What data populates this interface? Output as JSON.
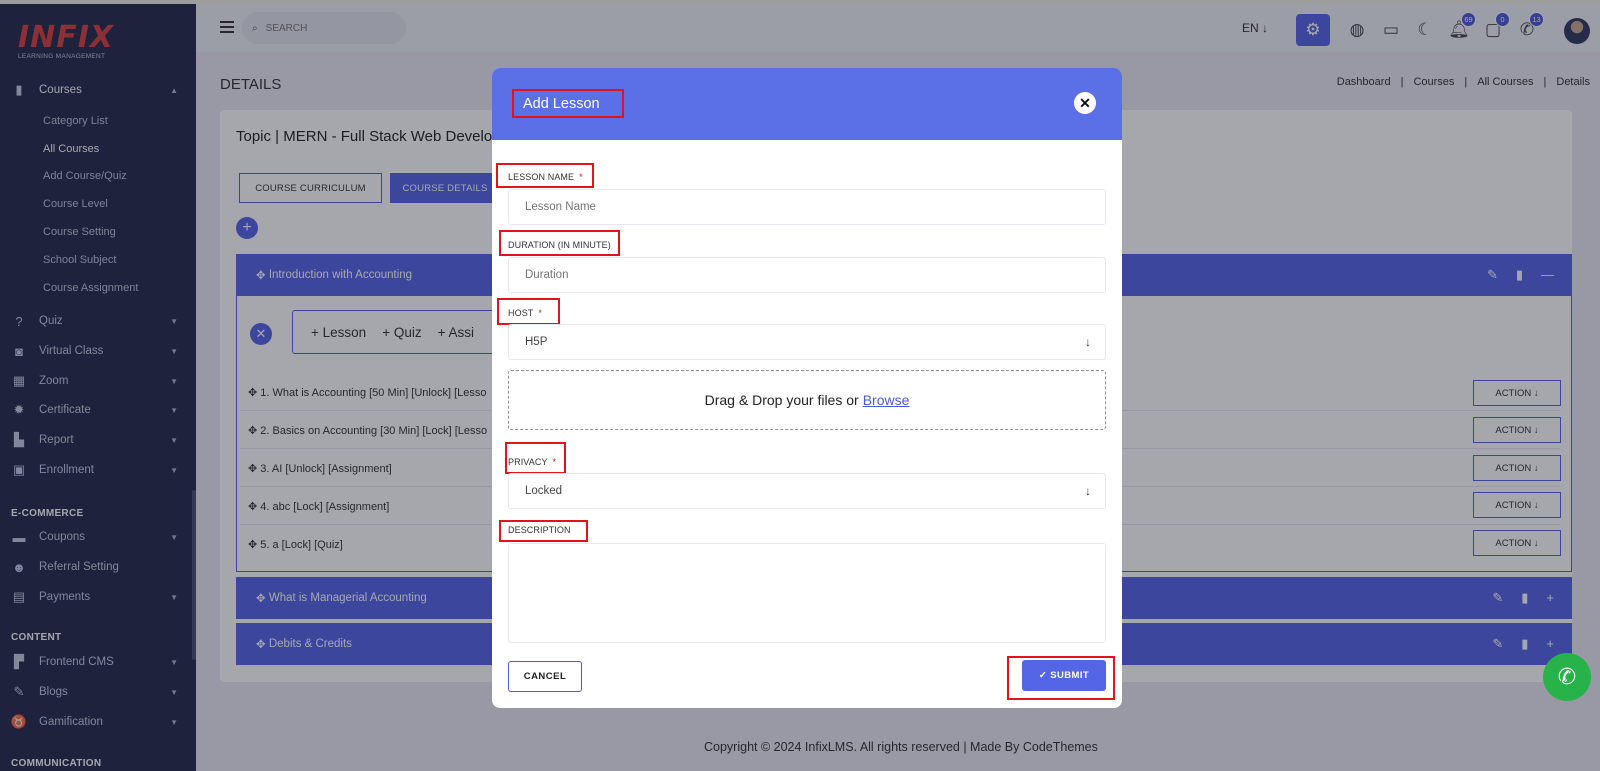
{
  "sidebar": {
    "logo_text": "INFIX",
    "logo_sub": "LEARNING MANAGEMENT",
    "items": [
      {
        "label": "Courses",
        "icon": "book-icon"
      },
      {
        "label": "Quiz",
        "icon": "question-icon"
      },
      {
        "label": "Virtual Class",
        "icon": "vr-icon"
      },
      {
        "label": "Zoom",
        "icon": "grid-icon"
      },
      {
        "label": "Certificate",
        "icon": "gear-badge-icon"
      },
      {
        "label": "Report",
        "icon": "chart-icon"
      },
      {
        "label": "Enrollment",
        "icon": "enroll-icon"
      },
      {
        "label": "Coupons",
        "icon": "coupon-icon"
      },
      {
        "label": "Referral Setting",
        "icon": "users-icon"
      },
      {
        "label": "Payments",
        "icon": "money-icon"
      },
      {
        "label": "Frontend CMS",
        "icon": "paint-roller-icon"
      },
      {
        "label": "Blogs",
        "icon": "edit-icon"
      },
      {
        "label": "Gamification",
        "icon": "trophy-icon"
      }
    ],
    "course_sub": [
      "Category List",
      "All Courses",
      "Add Course/Quiz",
      "Course Level",
      "Course Setting",
      "School Subject",
      "Course Assignment"
    ],
    "sections": {
      "ecommerce": "E-COMMERCE",
      "content": "CONTENT",
      "communication": "COMMUNICATION"
    }
  },
  "header": {
    "search_placeholder": "SEARCH",
    "lang": "EN",
    "notif_count": "69",
    "chat_count": "0",
    "whatsapp_count": "13"
  },
  "page": {
    "title": "DETAILS",
    "breadcrumbs": [
      "Dashboard",
      "|",
      "Courses",
      "|",
      "All Courses",
      "|",
      "Details"
    ],
    "topic": "Topic | MERN - Full Stack Web Develo",
    "tabs": [
      "COURSE CURRICULUM",
      "COURSE DETAILS"
    ],
    "sections": [
      "Introduction with Accounting",
      "What is Managerial Accounting",
      "Debits & Credits"
    ],
    "add_options": [
      "Lesson",
      "Quiz",
      "Assi"
    ],
    "lessons": [
      "1. What is Accounting [50 Min] [Unlock] [Lesso",
      "2. Basics on Accounting [30 Min] [Lock] [Lesso",
      "3. AI [Unlock] [Assignment]",
      "4. abc [Lock] [Assignment]",
      "5. a [Lock] [Quiz]"
    ],
    "action_label": "ACTION",
    "footer": "Copyright © 2024 InfixLMS. All rights reserved | Made By CodeThemes"
  },
  "modal": {
    "title": "Add Lesson",
    "lesson_name_label": "LESSON NAME",
    "lesson_name_placeholder": "Lesson Name",
    "duration_label": "DURATION (IN MINUTE)",
    "duration_placeholder": "Duration",
    "host_label": "HOST",
    "host_value": "H5P",
    "drop_text": "Drag & Drop your files or",
    "browse": "Browse",
    "privacy_label": "PRIVACY",
    "privacy_value": "Locked",
    "description_label": "DESCRIPTION",
    "cancel": "CANCEL",
    "submit": "SUBMIT",
    "required_mark": "*"
  },
  "colors": {
    "primary": "#5465e6",
    "sidebar": "#242a4a",
    "highlight": "#e0141a"
  }
}
